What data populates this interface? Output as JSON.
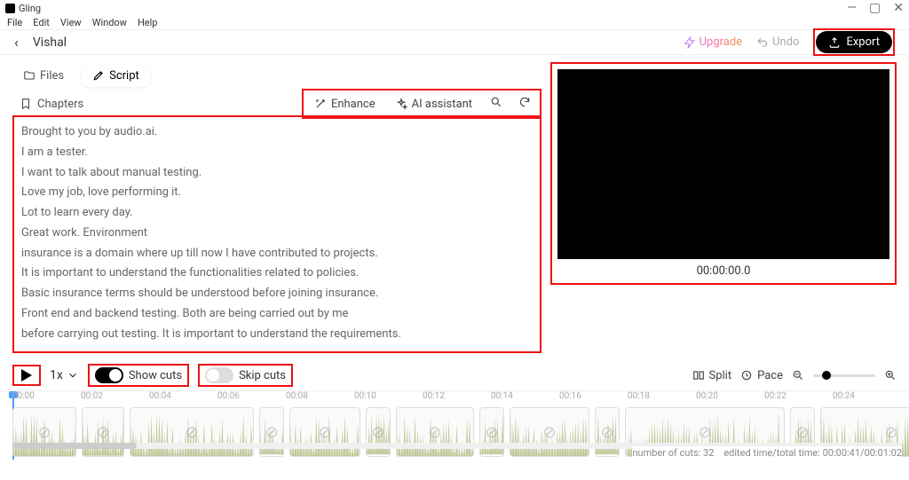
{
  "app": {
    "title": "Gling"
  },
  "menubar": [
    "File",
    "Edit",
    "View",
    "Window",
    "Help"
  ],
  "header": {
    "project_name": "Vishal",
    "upgrade_label": "Upgrade",
    "undo_label": "Undo",
    "export_label": "Export"
  },
  "left": {
    "tab_files": "Files",
    "tab_script": "Script",
    "chapters_label": "Chapters",
    "enhance_label": "Enhance",
    "ai_label": "AI assistant"
  },
  "transcript": [
    "Brought to you by audio.ai.",
    "I am a tester.",
    "I want to talk about manual testing.",
    "Love my job, love performing it.",
    "Lot to learn every day.",
    "Great work. Environment",
    "insurance is a domain where up till now I have contributed to projects.",
    "It is important to understand the functionalities related to policies.",
    "Basic insurance terms should be understood before joining insurance.",
    "Front end and backend testing. Both are being carried out by me",
    "before carrying out testing. It is important to understand the requirements."
  ],
  "preview": {
    "timecode": "00:00:00.0"
  },
  "controls": {
    "speed": "1x",
    "show_cuts": "Show cuts",
    "skip_cuts": "Skip cuts",
    "split": "Split",
    "pace": "Pace"
  },
  "ruler": [
    "00:00",
    "00:02",
    "00:04",
    "00:06",
    "00:08",
    "00:10",
    "00:12",
    "00:14",
    "00:16",
    "00:18",
    "00:20",
    "00:22",
    "00:24"
  ],
  "status": {
    "cuts": "number of cuts: 32",
    "time": "edited time/total time: 00:00:41/00:01:02"
  }
}
